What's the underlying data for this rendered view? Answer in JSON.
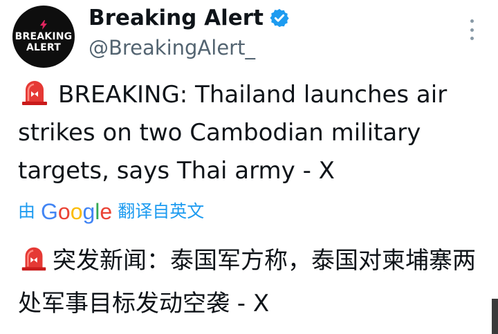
{
  "account": {
    "avatar_line1": "BREAKING",
    "avatar_line2": "ALERT",
    "display_name": "Breaking Alert",
    "handle": "@BreakingAlert_",
    "verified": true
  },
  "tweet": {
    "siren_icon": "rotating-light-emoji",
    "text": "BREAKING: Thailand launches air strikes on two Cambodian military targets, says Thai army - X"
  },
  "translation": {
    "prefix": "由",
    "provider": "Google",
    "label": "翻译自英文",
    "text": "突发新闻：泰国军方称，泰国对柬埔寨两处军事目标发动空袭 - X"
  },
  "colors": {
    "link": "#1d9bf0",
    "verified": "#1d9bf0",
    "handle": "#536471",
    "text": "#0f1419",
    "avatar_bg": "#0e0e0e",
    "bolt": "#e0245e"
  }
}
